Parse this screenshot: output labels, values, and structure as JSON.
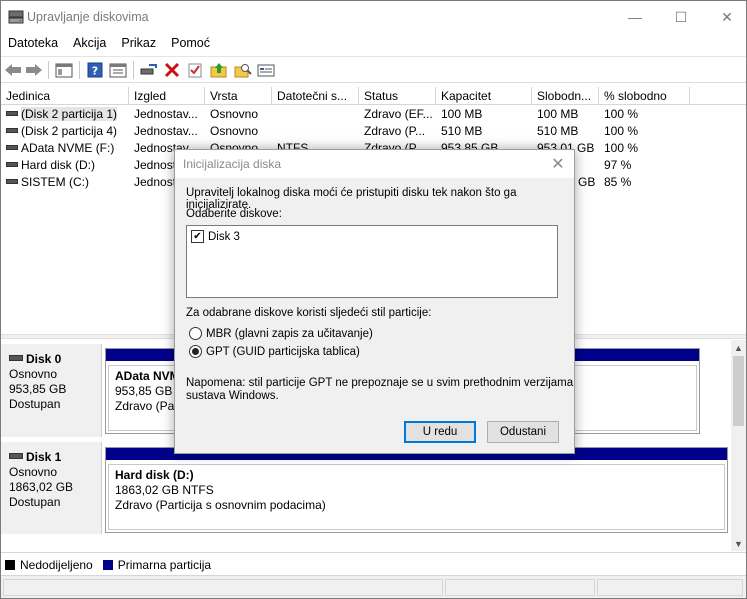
{
  "window": {
    "title": "Upravljanje diskovima"
  },
  "caption": {
    "minimize": "—",
    "maximize": "☐",
    "close": "✕"
  },
  "menu": [
    "Datoteka",
    "Akcija",
    "Prikaz",
    "Pomoć"
  ],
  "toolbar_icons": [
    "back-arrow-icon",
    "forward-arrow-icon",
    "show-hide-pane-icon",
    "help-icon",
    "properties-icon",
    "connect-icon",
    "delete-icon",
    "check-icon",
    "folder-up-icon",
    "search-folder-icon",
    "console-icon"
  ],
  "volume_list": {
    "columns": [
      "Jedinica",
      "Izgled",
      "Vrsta",
      "Datotečni s...",
      "Status",
      "Kapacitet",
      "Slobodn...",
      "% slobodno"
    ],
    "rows": [
      [
        "(Disk 2 particija 1)",
        "Jednostav...",
        "Osnovno",
        "",
        "Zdravo (EF...",
        "100 MB",
        "100 MB",
        "100 %"
      ],
      [
        "(Disk 2 particija 4)",
        "Jednostav...",
        "Osnovno",
        "",
        "Zdravo (P...",
        "510 MB",
        "510 MB",
        "100 %"
      ],
      [
        "AData NVME (F:)",
        "Jednostav...",
        "Osnovno",
        "NTFS",
        "Zdravo (P...",
        "953,85 GB",
        "953,01 GB",
        "100 %"
      ],
      [
        "Hard disk (D:)",
        "Jednost...",
        "",
        "",
        "",
        "",
        "",
        "97 %"
      ],
      [
        "SISTEM (C:)",
        "Jednost...",
        "",
        "",
        "",
        "",
        "GB",
        "85 %"
      ]
    ]
  },
  "disks": [
    {
      "title": "Disk 0",
      "type": "Osnovno",
      "size": "953,85 GB",
      "state": "Dostupan",
      "partition": {
        "name": "AData NVME (F:)",
        "detail": "953,85 GB NTFS",
        "status": "Zdravo (Particija s osnovnim podacima)"
      }
    },
    {
      "title": "Disk 1",
      "type": "Osnovno",
      "size": "1863,02 GB",
      "state": "Dostupan",
      "partition": {
        "name": "Hard disk  (D:)",
        "detail": "1863,02 GB NTFS",
        "status": "Zdravo (Particija s osnovnim podacima)"
      }
    }
  ],
  "legend": [
    {
      "label": "Nedodijeljeno",
      "color": "#000000"
    },
    {
      "label": "Primarna particija",
      "color": "#00008b"
    }
  ],
  "dialog": {
    "title": "Inicijalizacija diska",
    "intro": "Upravitelj lokalnog diska moći će pristupiti disku tek nakon što ga inicijalizirate.",
    "select_label": "Odaberite diskove:",
    "disk_item": {
      "label": "Disk 3",
      "checked": true
    },
    "style_label": "Za odabrane diskove koristi sljedeći stil particije:",
    "options": [
      {
        "label": "MBR (glavni zapis za učitavanje)",
        "checked": false
      },
      {
        "label": "GPT (GUID particijska tablica)",
        "checked": true
      }
    ],
    "note_line1": "Napomena: stil particije GPT ne prepoznaje se u svim prethodnim verzijama",
    "note_line2": "sustava Windows.",
    "ok_label": "U redu",
    "cancel_label": "Odustani"
  }
}
